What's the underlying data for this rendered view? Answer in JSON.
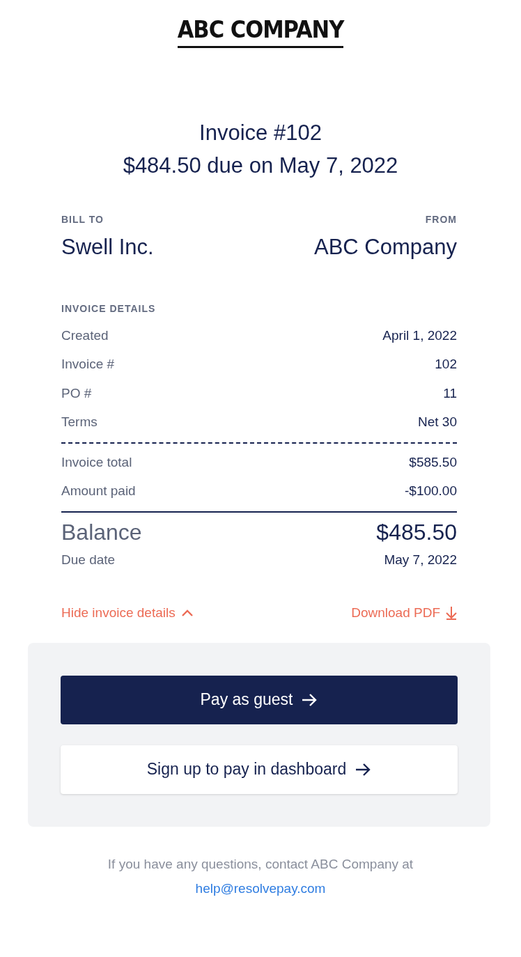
{
  "logo": {
    "text": "ABC COMPANY"
  },
  "header": {
    "title": "Invoice #102",
    "due": "$484.50 due on May 7, 2022"
  },
  "parties": [
    {
      "label": "BILL TO",
      "name": "Swell Inc."
    },
    {
      "label": "FROM",
      "name": "ABC Company"
    }
  ],
  "details": {
    "heading": "INVOICE DETAILS",
    "rows": [
      {
        "label": "Created",
        "value": "April 1, 2022"
      },
      {
        "label": "Invoice #",
        "value": "102"
      },
      {
        "label": "PO #",
        "value": "11"
      },
      {
        "label": "Terms",
        "value": "Net 30"
      }
    ]
  },
  "totals": [
    {
      "label": "Invoice total",
      "value": "$585.50"
    },
    {
      "label": "Amount paid",
      "value": "-$100.00"
    }
  ],
  "balance": {
    "label": "Balance",
    "value": "$485.50"
  },
  "due_date": {
    "label": "Due date",
    "value": "May 7, 2022"
  },
  "links": [
    {
      "label": "Hide invoice details",
      "kind": "collapse"
    },
    {
      "label": "Download PDF",
      "kind": "download"
    }
  ],
  "actions": [
    {
      "label": "Pay as guest",
      "kind": "primary"
    },
    {
      "label": "Sign up to pay in dashboard",
      "kind": "secondary"
    }
  ],
  "footer": {
    "text": "If you have any questions, contact ABC Company at",
    "email": "help@resolvepay.com"
  }
}
